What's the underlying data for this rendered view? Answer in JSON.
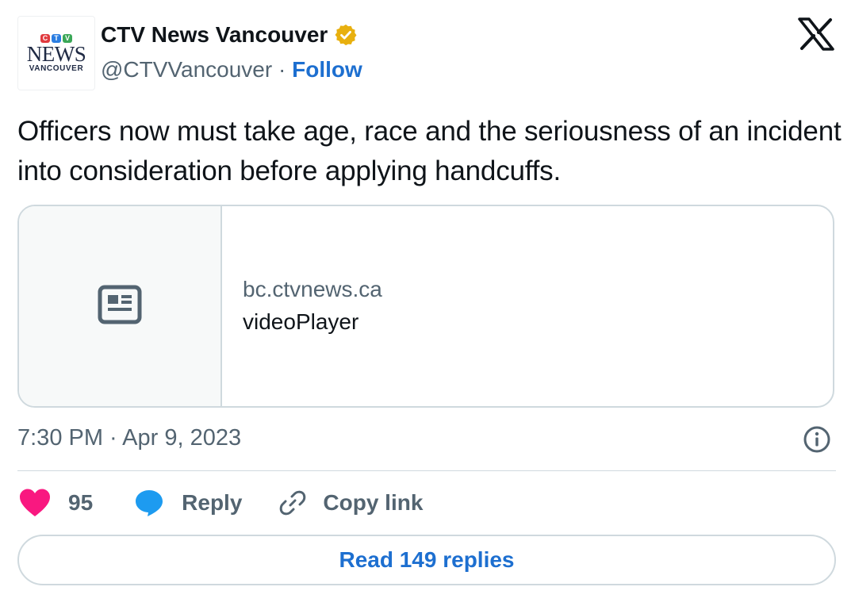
{
  "author": {
    "avatar": {
      "logo_letters": [
        "C",
        "T",
        "V"
      ],
      "logo_word": "NEWS",
      "logo_city": "VANCOUVER"
    },
    "display_name": "CTV News Vancouver",
    "handle": "@CTVVancouver",
    "separator": " · ",
    "follow_label": "Follow",
    "verified_badge_color": "#e8b00f"
  },
  "platform_icon": "x-logo-icon",
  "tweet": {
    "text": "Officers now must take age, race and the seriousness of an incident into consideration before applying handcuffs."
  },
  "card": {
    "media_icon": "newspaper-icon",
    "domain": "bc.ctvnews.ca",
    "title": "videoPlayer"
  },
  "timestamp": "7:30 PM · Apr 9, 2023",
  "actions": {
    "like_count": "95",
    "reply_label": "Reply",
    "copy_link_label": "Copy link"
  },
  "read_replies_label": "Read 149 replies",
  "colors": {
    "accent": "#1d6fd0",
    "like": "#f91880",
    "reply_icon": "#1d9bf0",
    "secondary_text": "#536471",
    "border": "#cfd9de"
  }
}
